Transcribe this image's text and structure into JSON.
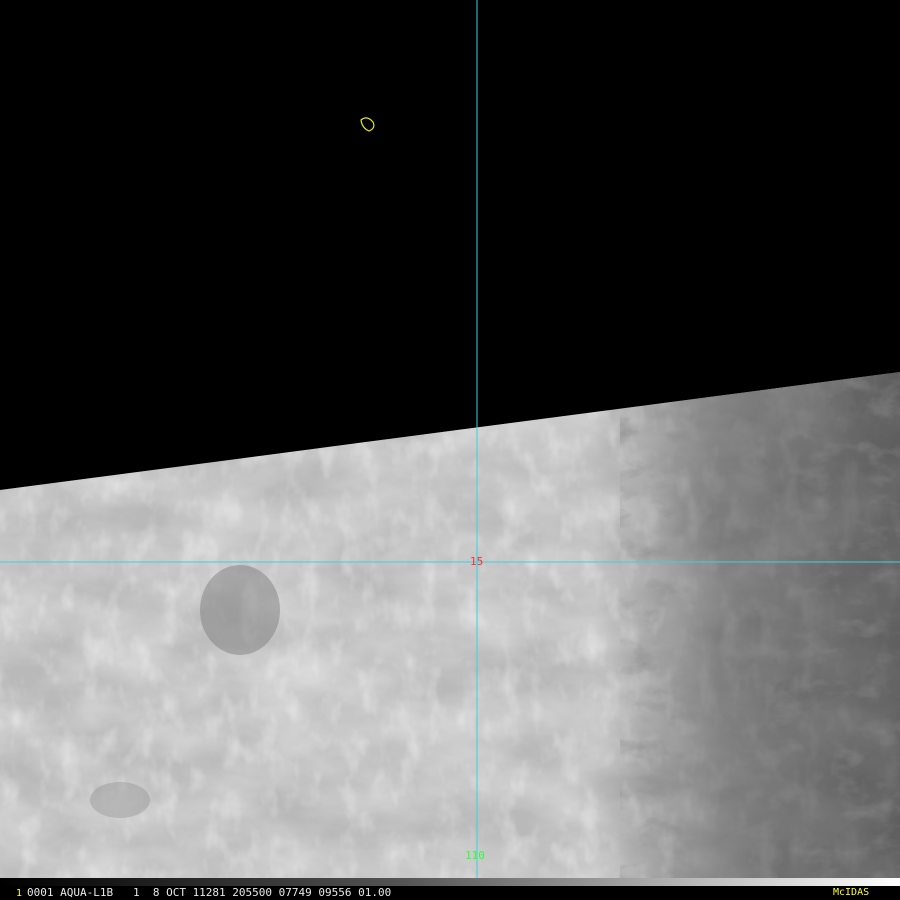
{
  "image": {
    "description_colors": {
      "space": "#000000",
      "grid_line": "#40d0e0",
      "coastline": "#e8e820",
      "lat_label": "#ff3030",
      "lon_label": "#30ff30",
      "logo": "#ffff40"
    }
  },
  "grid": {
    "lat_label": "15",
    "lon_label": "110"
  },
  "status": {
    "frame_number": "1",
    "text": "0001 AQUA-L1B   1  8 OCT 11281 205500 07749 09556 01.00",
    "logo": "McIDAS"
  }
}
